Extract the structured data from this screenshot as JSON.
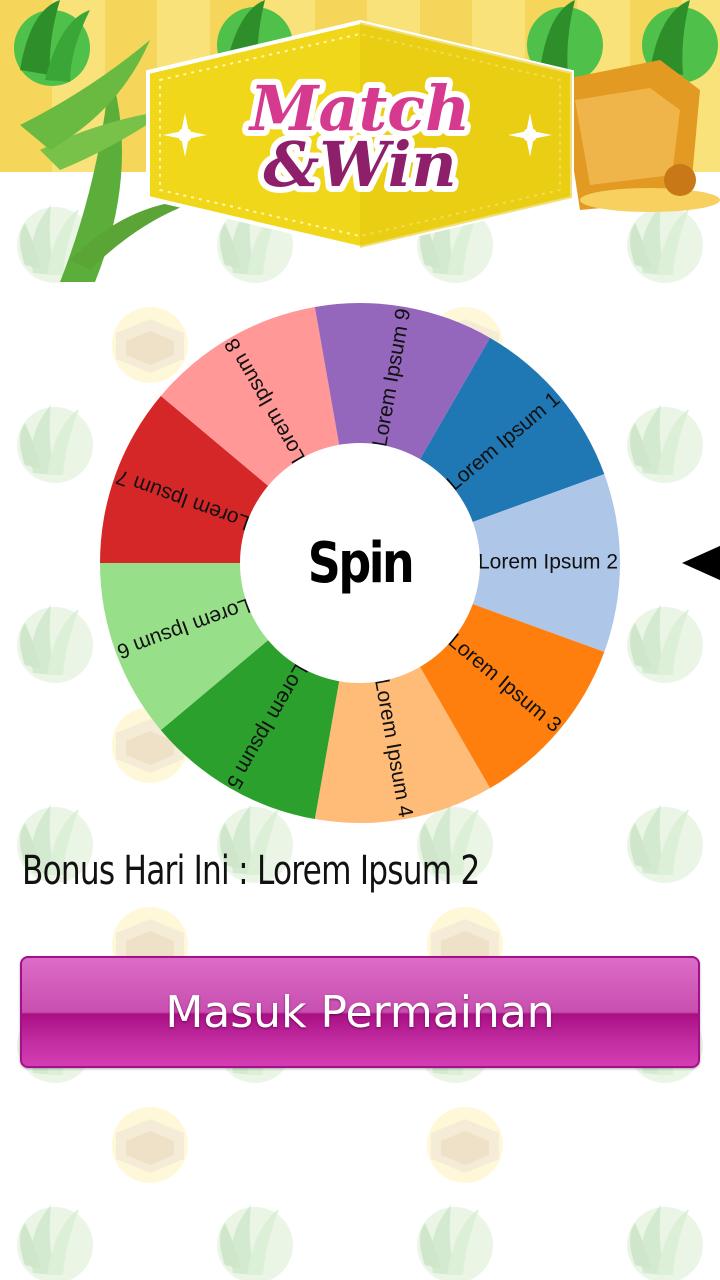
{
  "header": {
    "logo_line1": "Match",
    "logo_line2": "&Win"
  },
  "wheel": {
    "center_label": "Spin",
    "segments": [
      {
        "label": "Lorem Ipsum 1",
        "color": "#1f77b4"
      },
      {
        "label": "Lorem Ipsum 2",
        "color": "#aec7e8"
      },
      {
        "label": "Lorem Ipsum 3",
        "color": "#ff7f0e"
      },
      {
        "label": "Lorem Ipsum 4",
        "color": "#ffbb78"
      },
      {
        "label": "Lorem Ipsum 5",
        "color": "#2ca02c"
      },
      {
        "label": "Lorem Ipsum 6",
        "color": "#98df8a"
      },
      {
        "label": "Lorem Ipsum 7",
        "color": "#d62728"
      },
      {
        "label": "Lorem Ipsum 8",
        "color": "#ff9896"
      },
      {
        "label": "Lorem Ipsum 9",
        "color": "#9467bd"
      }
    ]
  },
  "bonus": {
    "text": "Bonus Hari Ini : Lorem Ipsum 2"
  },
  "enter_button": {
    "label": "Masuk Permainan"
  },
  "colors": {
    "button_accent": "#c42ea3",
    "logo_pink": "#d63a8e",
    "banner_yellow": "#f1d719"
  }
}
